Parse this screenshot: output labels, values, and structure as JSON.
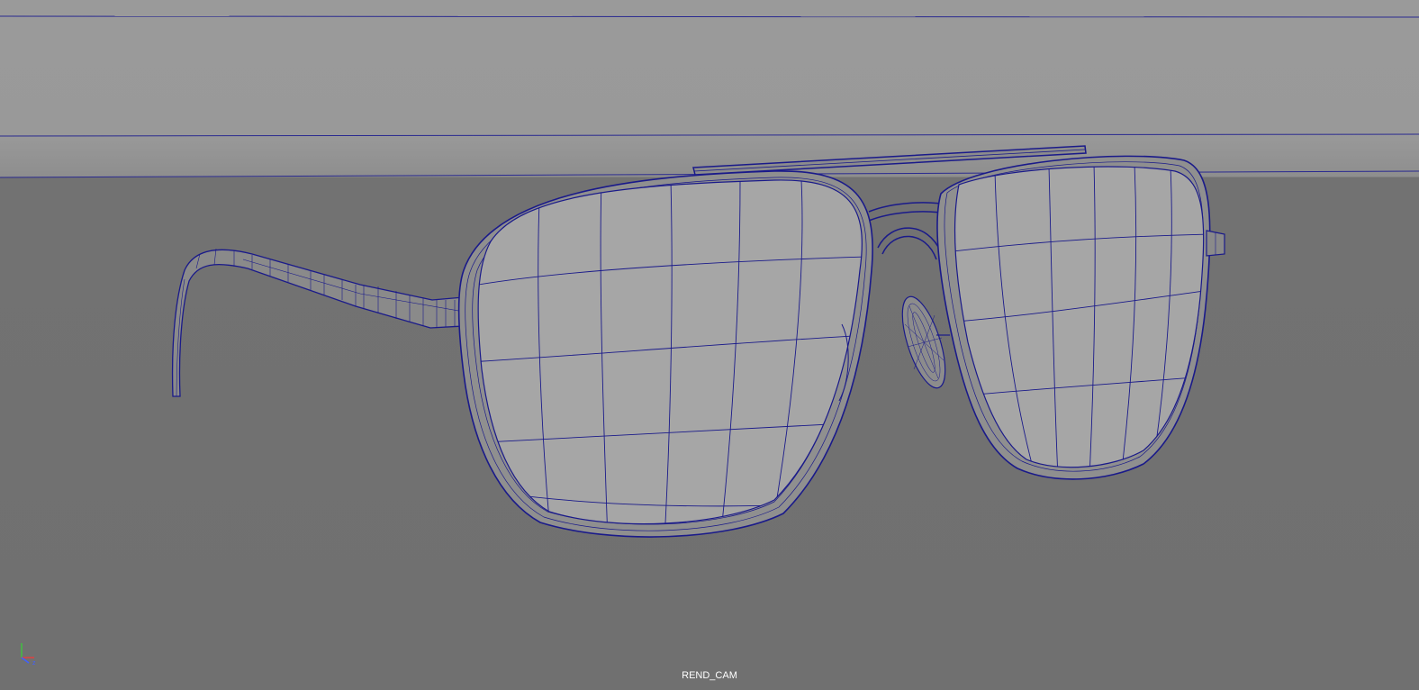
{
  "viewport": {
    "camera_label": "REND_CAM",
    "background_color": "#707070",
    "wireframe_color": "#1a1a8a",
    "object": "aviator-sunglasses-wireframe"
  },
  "axis_gizmo": {
    "icon": "xyz-axis-icon",
    "colors": {
      "x": "#e04040",
      "y": "#40c040",
      "z": "#4060ff"
    }
  }
}
